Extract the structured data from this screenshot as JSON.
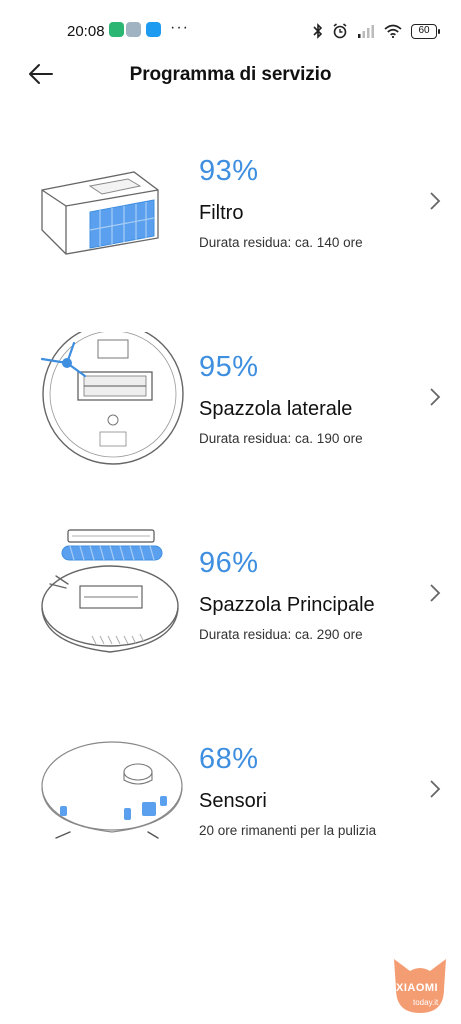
{
  "status_bar": {
    "time": "20:08",
    "dots": "···",
    "battery": "60",
    "icons": [
      "app-icon-green",
      "app-icon-grey",
      "app-icon-blue",
      "bluetooth-icon",
      "alarm-icon",
      "signal-icon",
      "wifi-icon",
      "battery-icon"
    ]
  },
  "header": {
    "title": "Programma di servizio",
    "back_icon": "arrow-left-icon"
  },
  "items": [
    {
      "percent": "93%",
      "name": "Filtro",
      "desc": "Durata residua: ca. 140 ore",
      "illustration": "filter-illustration"
    },
    {
      "percent": "95%",
      "name": "Spazzola laterale",
      "desc": "Durata residua: ca. 190 ore",
      "illustration": "side-brush-illustration"
    },
    {
      "percent": "96%",
      "name": "Spazzola Principale",
      "desc": "Durata residua: ca. 290 ore",
      "illustration": "main-brush-illustration"
    },
    {
      "percent": "68%",
      "name": "Sensori",
      "desc": "20 ore rimanenti per la pulizia",
      "illustration": "sensors-illustration"
    }
  ],
  "watermark": {
    "brand": "XIAOMI",
    "site": "today.it"
  },
  "colors": {
    "accent": "#3f8fe0",
    "highlight": "#5aa0ee"
  }
}
